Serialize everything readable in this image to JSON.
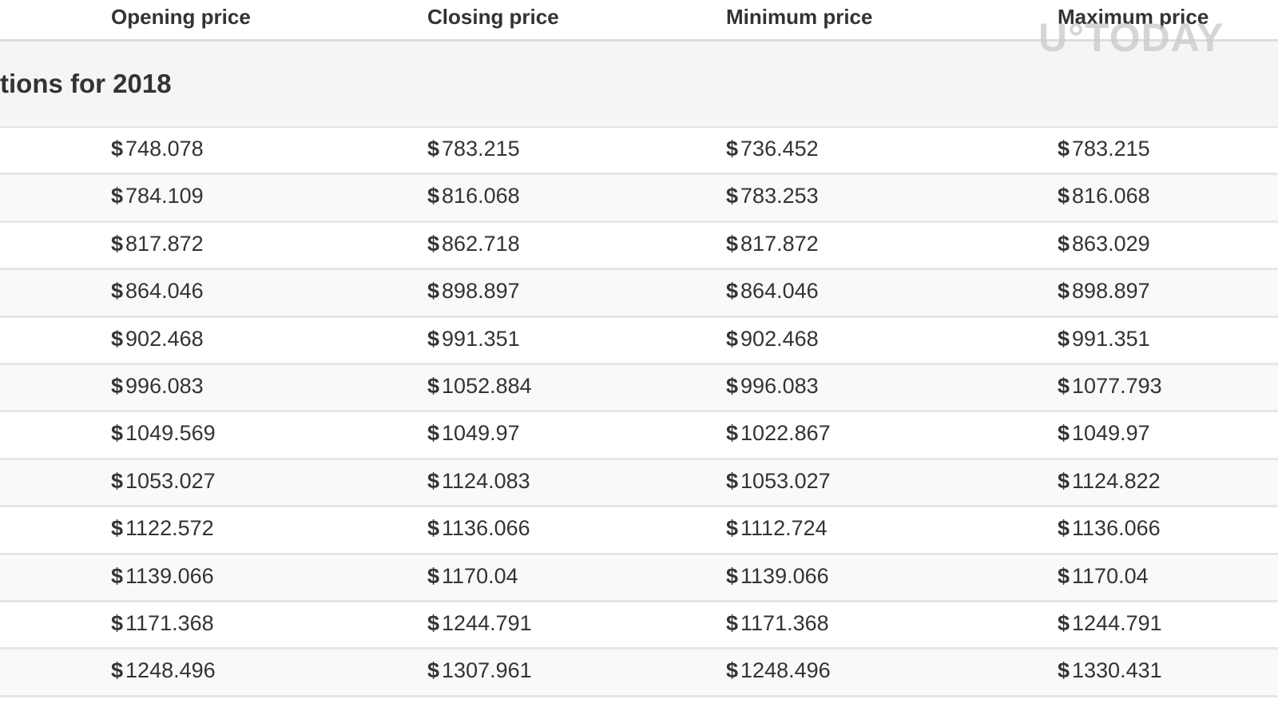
{
  "table": {
    "headers": [
      "Opening price",
      "Closing price",
      "Minimum price",
      "Maximum price"
    ],
    "section_title": "tions for 2018",
    "currency_symbol": "$",
    "rows": [
      [
        "748.078",
        "783.215",
        "736.452",
        "783.215"
      ],
      [
        "784.109",
        "816.068",
        "783.253",
        "816.068"
      ],
      [
        "817.872",
        "862.718",
        "817.872",
        "863.029"
      ],
      [
        "864.046",
        "898.897",
        "864.046",
        "898.897"
      ],
      [
        "902.468",
        "991.351",
        "902.468",
        "991.351"
      ],
      [
        "996.083",
        "1052.884",
        "996.083",
        "1077.793"
      ],
      [
        "1049.569",
        "1049.97",
        "1022.867",
        "1049.97"
      ],
      [
        "1053.027",
        "1124.083",
        "1053.027",
        "1124.822"
      ],
      [
        "1122.572",
        "1136.066",
        "1112.724",
        "1136.066"
      ],
      [
        "1139.066",
        "1170.04",
        "1139.066",
        "1170.04"
      ],
      [
        "1171.368",
        "1244.791",
        "1171.368",
        "1244.791"
      ],
      [
        "1248.496",
        "1307.961",
        "1248.496",
        "1330.431"
      ]
    ]
  },
  "watermark": "U°TODAY"
}
